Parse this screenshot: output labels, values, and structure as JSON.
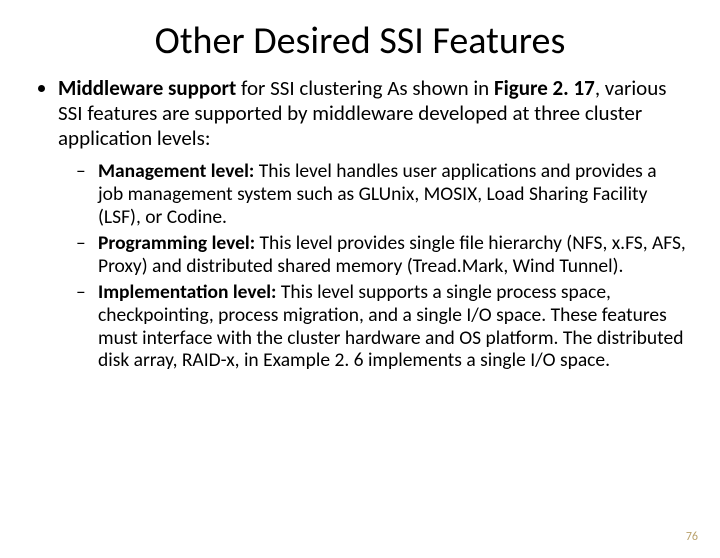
{
  "title": "Other Desired SSI Features",
  "top": {
    "lead_bold": "Middleware support ",
    "lead_rest": "for SSI clustering As shown in ",
    "fig_bold": "Figure 2. 17",
    "lead_tail": ", various SSI features are supported by middleware developed at three cluster application levels:"
  },
  "items": [
    {
      "label": "Management level: ",
      "text": "This level handles user applications and provides a job management system such as GLUnix, MOSIX, Load Sharing Facility (LSF), or Codine."
    },
    {
      "label": "Programming level: ",
      "text": "This level provides single file hierarchy (NFS, x.FS, AFS, Proxy) and distributed shared memory (Tread.Mark, Wind Tunnel)."
    },
    {
      "label": "Implementation level: ",
      "text": "This level supports a single process space, checkpointing, process migration, and a single I/O space. These features must interface with the cluster hardware and OS platform. The distributed disk array, RAID-x, in Example 2. 6 implements a single I/O space."
    }
  ],
  "page_number": "76"
}
